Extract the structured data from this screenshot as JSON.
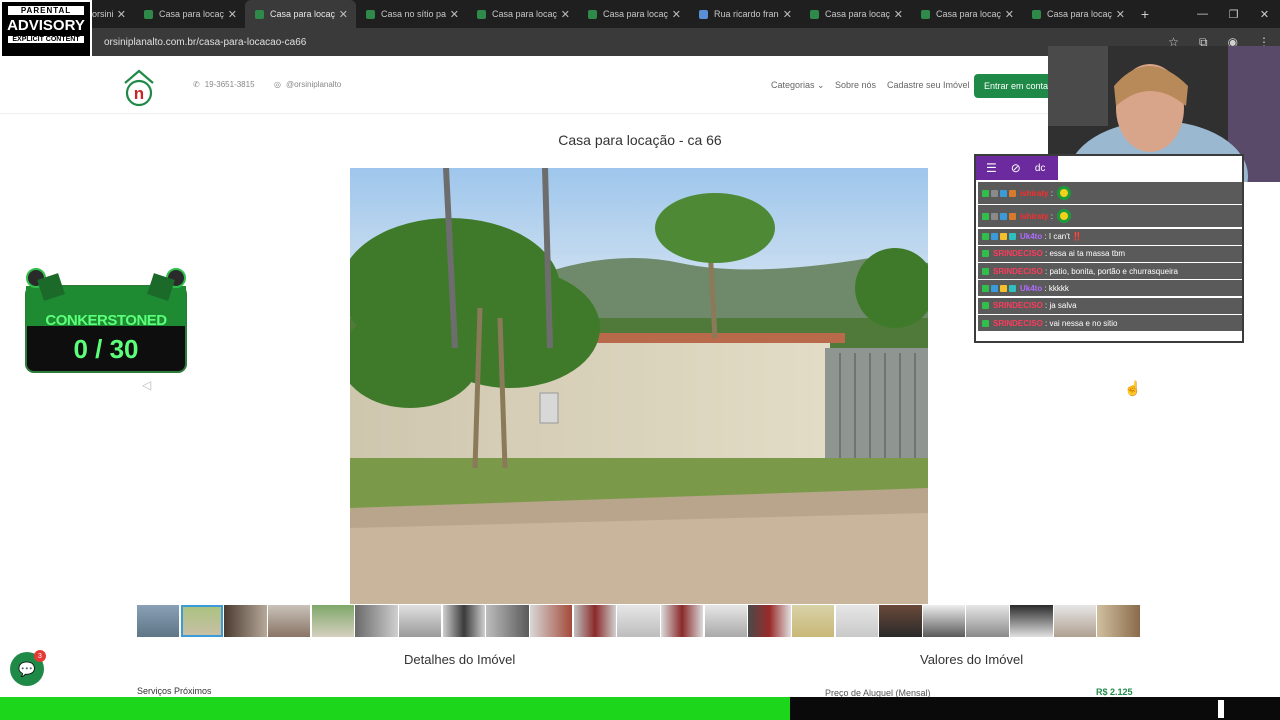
{
  "browser": {
    "tabs": [
      {
        "label": "orsini"
      },
      {
        "label": "Casa para locação"
      },
      {
        "label": "Casa para locação",
        "active": true
      },
      {
        "label": "Casa no sítio para"
      },
      {
        "label": "Casa para locação"
      },
      {
        "label": "Casa para locação"
      },
      {
        "label": "Rua ricardo franci"
      },
      {
        "label": "Casa para locação"
      },
      {
        "label": "Casa para locação"
      },
      {
        "label": "Casa para locação"
      }
    ],
    "new_tab": "+",
    "url": "orsiniplanalto.com.br/casa-para-locacao-ca66"
  },
  "advisory": {
    "l1": "PARENTAL",
    "l2": "ADVISORY",
    "l3": "EXPLICIT CONTENT"
  },
  "header": {
    "phone": "19-3651-3815",
    "instagram": "@orsiniplanalto",
    "nav": {
      "categorias": "Categorias",
      "sobre": "Sobre nós",
      "cadastre": "Cadastre seu Imóvel"
    },
    "cta": "Entrar em contato"
  },
  "page": {
    "title": "Casa para locação - ca 66",
    "details_heading": "Detalhes do Imóvel",
    "values_heading": "Valores do Imóvel",
    "services_label": "Serviços Próximos",
    "rent_label": "Preço de Aluguel (Mensal)",
    "rent_value": "R$ 2.125"
  },
  "counter": {
    "label": "CONKERSTONED",
    "value": "0 / 30"
  },
  "chat": {
    "header_label": "dc",
    "messages": [
      {
        "user": "ishiraty",
        "text": "",
        "flag": true,
        "user_color": "#ff2b2b"
      },
      {
        "user": "ishiraty",
        "text": "",
        "flag": true,
        "user_color": "#ff2b2b"
      },
      {
        "user": "Uk4to",
        "text": "I can't ‼️",
        "user_color": "#b06bff"
      },
      {
        "user": "SRINDECISO",
        "text": "essa ai ta massa tbm",
        "user_color": "#ff3b5c"
      },
      {
        "user": "SRINDECISO",
        "text": "patio, bonita, portão e churrasqueira",
        "user_color": "#ff3b5c"
      },
      {
        "user": "Uk4to",
        "text": "kkkkk",
        "user_color": "#b06bff"
      },
      {
        "user": "SRINDECISO",
        "text": "ja salva",
        "user_color": "#ff3b5c"
      },
      {
        "user": "SRINDECISO",
        "text": "vai nessa e no sitio",
        "user_color": "#ff3b5c"
      }
    ]
  },
  "chat_widget": {
    "count": "3"
  },
  "colors": {
    "brand_green": "#1f8a48",
    "stream_green": "#1bd61b",
    "chat_purple": "#6b2b9e"
  }
}
